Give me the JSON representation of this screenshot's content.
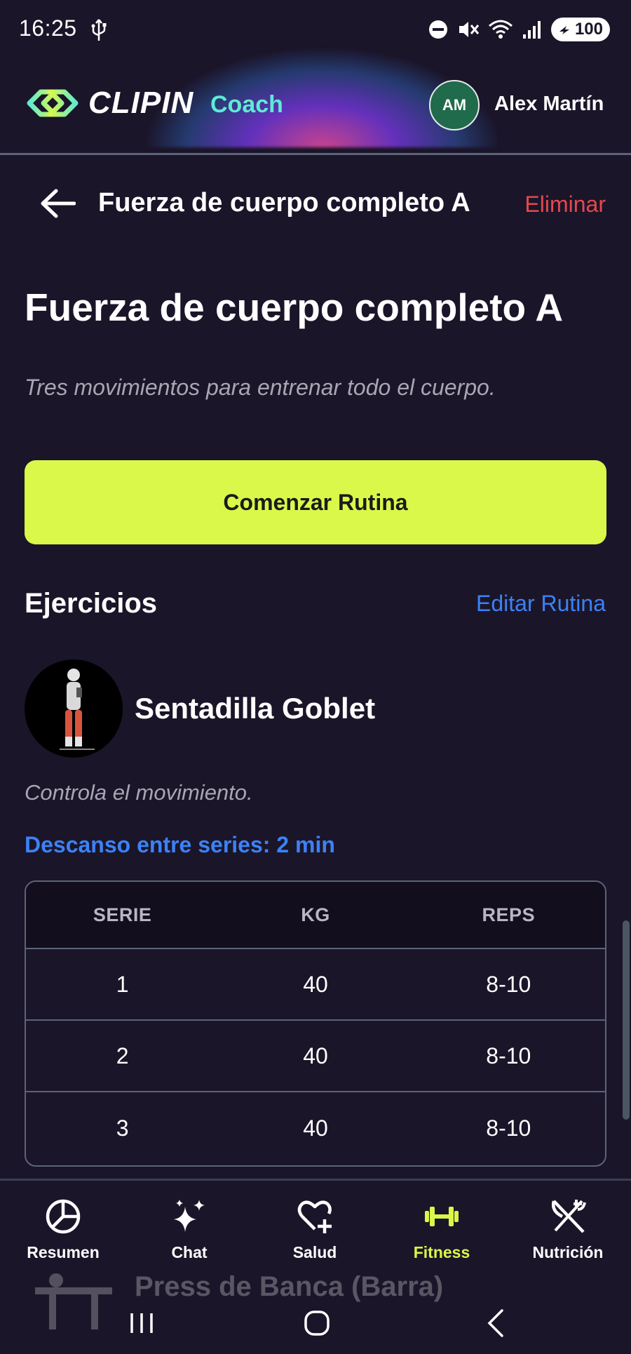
{
  "status_bar": {
    "time": "16:25",
    "battery": "100",
    "icons": [
      "usb-icon",
      "dnd-icon",
      "mute-icon",
      "wifi-icon",
      "signal-icon",
      "battery-icon"
    ]
  },
  "header": {
    "logo_text": "CLIPIN",
    "logo_sub": "Coach",
    "avatar_initials": "AM",
    "user_name": "Alex Martín"
  },
  "nav": {
    "title": "Fuerza de cuerpo completo A",
    "delete_label": "Eliminar"
  },
  "routine": {
    "title": "Fuerza de cuerpo completo A",
    "description": "Tres movimientos para entrenar todo el cuerpo.",
    "start_label": "Comenzar Rutina"
  },
  "exercises_section": {
    "title": "Ejercicios",
    "edit_label": "Editar Rutina"
  },
  "exercise": {
    "name": "Sentadilla Goblet",
    "note": "Controla el movimiento.",
    "rest": "Descanso entre series: 2 min",
    "columns": [
      "SERIE",
      "KG",
      "REPS"
    ],
    "sets": [
      {
        "serie": "1",
        "kg": "40",
        "reps": "8-10"
      },
      {
        "serie": "2",
        "kg": "40",
        "reps": "8-10"
      },
      {
        "serie": "3",
        "kg": "40",
        "reps": "8-10"
      }
    ]
  },
  "next_exercise_peek": "Press de Banca (Barra)",
  "bottom_nav": {
    "items": [
      {
        "label": "Resumen",
        "icon": "pie-chart-icon"
      },
      {
        "label": "Chat",
        "icon": "sparkles-icon"
      },
      {
        "label": "Salud",
        "icon": "heart-plus-icon"
      },
      {
        "label": "Fitness",
        "icon": "dumbbell-icon",
        "active": true
      },
      {
        "label": "Nutrición",
        "icon": "fork-knife-icon"
      }
    ]
  },
  "colors": {
    "background": "#1b1529",
    "accent": "#d9f84a",
    "link": "#3b82f6",
    "danger": "#e5484d"
  }
}
